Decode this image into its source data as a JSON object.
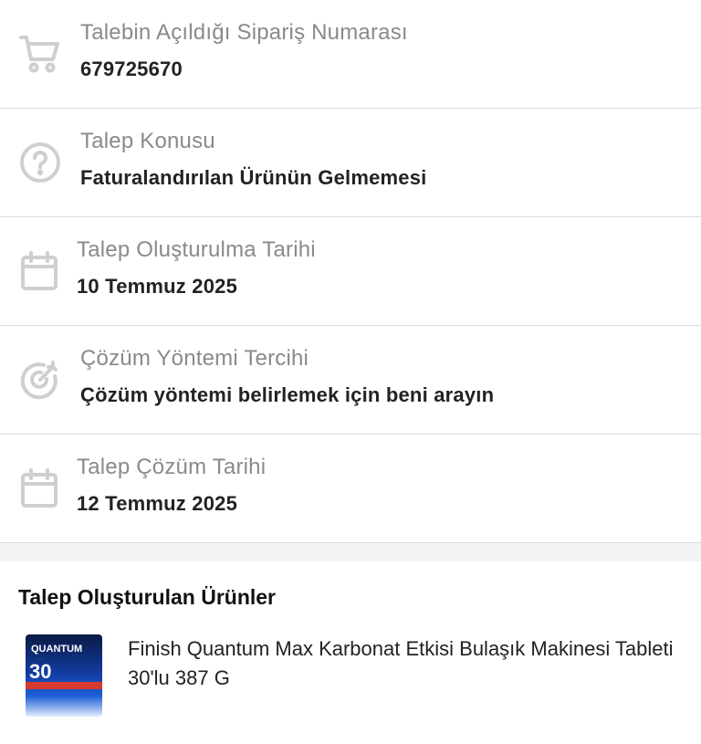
{
  "details": [
    {
      "label": "Talebin Açıldığı Sipariş Numarası",
      "value": "679725670",
      "icon": "cart-icon"
    },
    {
      "label": "Talep Konusu",
      "value": "Faturalandırılan Ürünün Gelmemesi",
      "icon": "question-icon"
    },
    {
      "label": "Talep Oluşturulma Tarihi",
      "value": "10 Temmuz 2025",
      "icon": "calendar-icon"
    },
    {
      "label": "Çözüm Yöntemi Tercihi",
      "value": "Çözüm yöntemi belirlemek için beni arayın",
      "icon": "target-icon"
    },
    {
      "label": "Talep Çözüm Tarihi",
      "value": "12 Temmuz 2025",
      "icon": "calendar-icon"
    }
  ],
  "products_section": {
    "heading": "Talep Oluşturulan Ürünler",
    "items": [
      {
        "name": "Finish Quantum Max Karbonat Etkisi Bulaşık Makinesi Tableti 30'lu 387 G",
        "thumb_text_1": "QUANTUM",
        "thumb_text_2": "30"
      }
    ]
  },
  "colors": {
    "label": "#8a8a8a",
    "value": "#222222",
    "icon": "#cfcfcf",
    "divider": "#dcdcdc",
    "section_bg": "#f2f3f5"
  }
}
